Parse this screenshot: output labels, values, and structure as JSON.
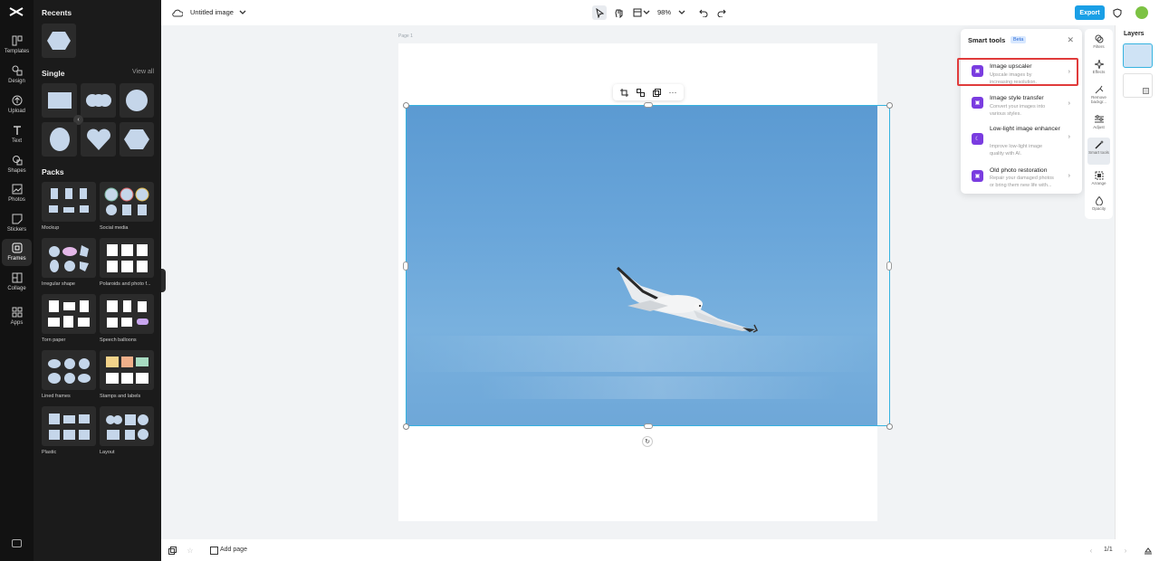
{
  "app": {
    "logo_icon": "capcut-logo-icon",
    "accent_color": "#1a9fe6"
  },
  "left_rail": {
    "items": [
      {
        "label": "Templates",
        "icon": "templates-icon"
      },
      {
        "label": "Design",
        "icon": "design-icon"
      },
      {
        "label": "Upload",
        "icon": "upload-icon"
      },
      {
        "label": "Text",
        "icon": "text-icon"
      },
      {
        "label": "Shapes",
        "icon": "shapes-icon"
      },
      {
        "label": "Photos",
        "icon": "photos-icon"
      },
      {
        "label": "Stickers",
        "icon": "stickers-icon"
      },
      {
        "label": "Frames",
        "icon": "frames-icon",
        "active": true
      },
      {
        "label": "Collage",
        "icon": "collage-icon"
      },
      {
        "label": "Apps",
        "icon": "apps-icon"
      }
    ]
  },
  "panel": {
    "recents_title": "Recents",
    "single_title": "Single",
    "view_all": "View all",
    "packs_title": "Packs",
    "packs": [
      {
        "label": "Mockup"
      },
      {
        "label": "Social media"
      },
      {
        "label": "Irregular shape"
      },
      {
        "label": "Polaroids and photo f..."
      },
      {
        "label": "Torn paper"
      },
      {
        "label": "Speech balloons"
      },
      {
        "label": "Lined frames"
      },
      {
        "label": "Stamps and labels"
      },
      {
        "label": "Plastic"
      },
      {
        "label": "Layout"
      }
    ]
  },
  "topbar": {
    "doc_title": "Untitled image",
    "zoom": "98%",
    "export_label": "Export"
  },
  "canvas": {
    "page_label": "Page 1"
  },
  "smart_tools": {
    "title": "Smart tools",
    "badge": "Beta",
    "tools": [
      {
        "title": "Image upscaler",
        "desc": "Upscale images by increasing resolution."
      },
      {
        "title": "Image style transfer",
        "desc": "Convert your images into various styles."
      },
      {
        "title": "Low-light image enhancer",
        "desc": "Improve low-light image quality with AI."
      },
      {
        "title": "Old photo restoration",
        "desc": "Repair your damaged photos or bring them new life with..."
      }
    ]
  },
  "tool_column": {
    "items": [
      {
        "label": "Filters"
      },
      {
        "label": "Effects"
      },
      {
        "label": "Remove backgr..."
      },
      {
        "label": "Adjust"
      },
      {
        "label": "Smart tools",
        "active": true
      },
      {
        "label": "Arrange"
      },
      {
        "label": "Opacity"
      }
    ]
  },
  "layers": {
    "title": "Layers"
  },
  "bottombar": {
    "add_page": "Add page",
    "page_count": "1/1"
  }
}
